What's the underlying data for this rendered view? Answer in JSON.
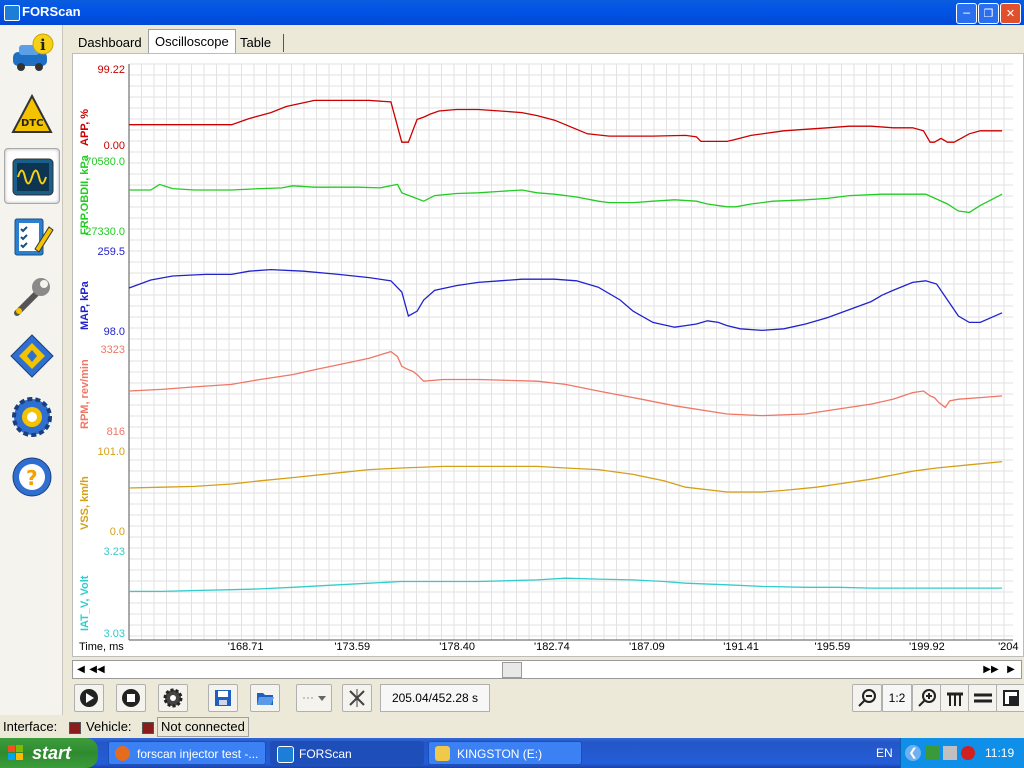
{
  "window": {
    "title": "FORScan",
    "controls": [
      "minimize-icon",
      "restore-icon",
      "close-icon"
    ]
  },
  "sidebar": {
    "items": [
      {
        "name": "vehicle-info",
        "icon": "car-info-icon",
        "active": false
      },
      {
        "name": "dtc",
        "icon": "dtc-warning-icon",
        "active": false
      },
      {
        "name": "oscilloscope",
        "icon": "oscilloscope-icon",
        "active": true
      },
      {
        "name": "tests",
        "icon": "checklist-icon",
        "active": false
      },
      {
        "name": "service",
        "icon": "wrench-icon",
        "active": false
      },
      {
        "name": "configuration",
        "icon": "chip-icon",
        "active": false
      },
      {
        "name": "settings",
        "icon": "gear-icon",
        "active": false
      },
      {
        "name": "help",
        "icon": "help-wheel-icon",
        "active": false
      }
    ]
  },
  "tabs": [
    {
      "label": "Dashboard",
      "selected": false
    },
    {
      "label": "Oscilloscope",
      "selected": true
    },
    {
      "label": "Table",
      "selected": false
    }
  ],
  "chart_data": {
    "type": "line",
    "xlabel": "Time, ms",
    "x_ticks": [
      "168.71",
      "173.59",
      "178.40",
      "182.74",
      "187.09",
      "191.41",
      "195.59",
      "199.92",
      "204"
    ],
    "grid": true,
    "series": [
      {
        "name": "APP, %",
        "color": "#cc0000",
        "ymax": "99.22",
        "ymin": "0.00",
        "x": [
          164.0,
          165.5,
          167,
          168.7,
          169.5,
          170.5,
          171.2,
          172.5,
          173.6,
          175.0,
          176.0,
          176.5,
          176.8,
          177.2,
          177.5,
          177.8,
          178.2,
          179.0,
          180.0,
          181.0,
          182.0,
          182.7,
          183.5,
          184.0,
          185.0,
          186.0,
          187.1,
          188.0,
          189.5,
          190.0,
          190.2,
          191.4,
          191.7,
          192.5,
          194.0,
          195.0,
          196.0,
          197.0,
          198.0,
          199.0,
          199.9,
          200.4,
          200.7,
          200.9,
          201.2,
          201.5,
          201.8,
          202.5,
          203.0,
          204.0
        ],
        "y": [
          28,
          28,
          28,
          28,
          36,
          44,
          52,
          60,
          60,
          60,
          58,
          5,
          5,
          35,
          38,
          42,
          46,
          48,
          48,
          46,
          44,
          40,
          34,
          28,
          16,
          13,
          13,
          13,
          14,
          12,
          6,
          6,
          8,
          14,
          20,
          22,
          24,
          26,
          26,
          24,
          24,
          20,
          5,
          5,
          10,
          5,
          5,
          16,
          20,
          20
        ]
      },
      {
        "name": "FRP.OBDII, kPa",
        "color": "#22cc22",
        "ymax": "70580.0",
        "ymin": "27330.0",
        "x": [
          164.0,
          165.0,
          165.4,
          166.0,
          167.0,
          168.7,
          170.0,
          171.0,
          171.5,
          172.5,
          173.6,
          174.5,
          175.5,
          176.3,
          176.5,
          177.0,
          177.5,
          178.0,
          179.0,
          180.0,
          181.0,
          182.0,
          182.7,
          183.5,
          184.5,
          185.5,
          186.0,
          187.1,
          188.0,
          189.0,
          190.0,
          190.5,
          191.4,
          191.8,
          192.5,
          193.5,
          195.0,
          196.0,
          197.0,
          198.5,
          199.9,
          200.5,
          201.5,
          202.0,
          202.5,
          203.0,
          204.0
        ],
        "y": [
          60,
          60,
          68,
          62,
          60,
          60,
          62,
          63,
          66,
          64,
          64,
          64,
          63,
          68,
          56,
          50,
          44,
          52,
          55,
          56,
          58,
          60,
          56,
          54,
          50,
          44,
          42,
          42,
          44,
          46,
          44,
          40,
          36,
          36,
          40,
          44,
          46,
          48,
          52,
          54,
          54,
          54,
          40,
          30,
          28,
          38,
          54
        ]
      },
      {
        "name": "MAP, kPa",
        "color": "#2222cc",
        "ymax": "259.5",
        "ymin": "98.0",
        "x": [
          164.0,
          164.5,
          165.0,
          166.0,
          167.5,
          168.7,
          169.5,
          170.5,
          172.0,
          173.6,
          175.0,
          176.0,
          176.5,
          176.8,
          177.2,
          177.5,
          178.0,
          179.0,
          180.0,
          181.0,
          182.0,
          182.7,
          183.5,
          184.5,
          185.5,
          186.5,
          187.1,
          188.0,
          189.0,
          189.5,
          190.0,
          190.5,
          191.0,
          191.4,
          192.0,
          193.0,
          194.0,
          195.0,
          196.0,
          197.0,
          198.0,
          198.5,
          199.0,
          199.9,
          200.5,
          201.0,
          201.5,
          202.0,
          202.5,
          203.0,
          204.0
        ],
        "y": [
          55,
          60,
          65,
          70,
          72,
          72,
          76,
          78,
          76,
          72,
          68,
          64,
          50,
          20,
          26,
          40,
          52,
          58,
          62,
          64,
          66,
          66,
          66,
          64,
          56,
          40,
          26,
          12,
          6,
          8,
          10,
          14,
          12,
          8,
          4,
          2,
          4,
          10,
          18,
          28,
          38,
          46,
          52,
          62,
          64,
          60,
          40,
          20,
          12,
          12,
          24
        ]
      },
      {
        "name": "RPM, rev/min",
        "color": "#ee7766",
        "ymax": "3323",
        "ymin": "816",
        "x": [
          164.0,
          165.5,
          167.0,
          168.7,
          170.0,
          171.5,
          172.5,
          173.6,
          175.0,
          176.0,
          176.3,
          176.5,
          176.8,
          177.0,
          177.2,
          177.5,
          178.4,
          180.0,
          182.7,
          184.0,
          185.5,
          187.1,
          189.0,
          191.4,
          193.0,
          195.0,
          196.5,
          198.0,
          199.0,
          199.9,
          200.4,
          200.7,
          200.9,
          201.1,
          201.4,
          201.6,
          202.0,
          203.0,
          204.0
        ],
        "y": [
          50,
          52,
          55,
          58,
          64,
          70,
          76,
          82,
          90,
          98,
          92,
          80,
          76,
          74,
          70,
          62,
          64,
          64,
          62,
          58,
          50,
          42,
          32,
          22,
          20,
          22,
          28,
          34,
          40,
          48,
          50,
          44,
          42,
          36,
          30,
          38,
          40,
          42,
          44
        ]
      },
      {
        "name": "VSS, km/h",
        "color": "#d4a017",
        "ymax": "101.0",
        "ymin": "0.0",
        "x": [
          164.0,
          165.5,
          167.0,
          168.7,
          170.0,
          171.5,
          173.6,
          175.0,
          176.5,
          178.4,
          180.0,
          182.7,
          184.0,
          185.5,
          187.1,
          188.5,
          189.5,
          191.4,
          193.0,
          194.0,
          195.5,
          196.5,
          198.0,
          199.9,
          201.0,
          202.5,
          204.0
        ],
        "y": [
          55,
          56,
          57,
          60,
          64,
          68,
          74,
          78,
          80,
          82,
          82,
          82,
          80,
          78,
          72,
          64,
          56,
          50,
          50,
          52,
          56,
          60,
          66,
          76,
          80,
          84,
          88
        ]
      },
      {
        "name": "IAT_V, Volt",
        "color": "#33cccc",
        "ymax": "3.23",
        "ymin": "3.03",
        "x": [
          164.0,
          165.5,
          167.0,
          168.7,
          170.0,
          171.5,
          173.6,
          175.0,
          176.5,
          178.4,
          180.0,
          182.7,
          184.0,
          185.5,
          187.1,
          188.5,
          189.5,
          191.4,
          193.0,
          195.0,
          196.5,
          198.0,
          199.9,
          201.0,
          202.5,
          204.0
        ],
        "y": [
          52,
          52,
          53,
          54,
          55,
          57,
          60,
          62,
          64,
          64,
          64,
          66,
          68,
          67,
          66,
          64,
          62,
          60,
          58,
          57,
          57,
          56,
          56,
          56,
          56,
          56
        ]
      }
    ]
  },
  "scrollbar": {
    "position": 0.452
  },
  "toolbar": {
    "time_readout": "205.04/452.28 s",
    "zoom_ratio": "1:2",
    "buttons": [
      "play-icon",
      "stop-icon",
      "settings-gear-icon",
      "save-icon",
      "open-folder-icon",
      "dropdown",
      "crossed-icon",
      "zoom-out-icon",
      "zoom-in-icon",
      "tick-icon",
      "hline-icon",
      "corner-icon"
    ]
  },
  "status": {
    "interface_label": "Interface:",
    "vehicle_label": "Vehicle:",
    "connection": "Not connected",
    "indicator_color": "#8b1c1c"
  },
  "taskbar": {
    "start_label": "start",
    "tasks": [
      {
        "label": "forscan injector test -...",
        "icon": "firefox-icon",
        "active": false
      },
      {
        "label": "FORScan",
        "icon": "forscan-icon",
        "active": true
      },
      {
        "label": "KINGSTON (E:)",
        "icon": "folder-icon",
        "active": false
      }
    ],
    "language": "EN",
    "clock": "11:19"
  }
}
